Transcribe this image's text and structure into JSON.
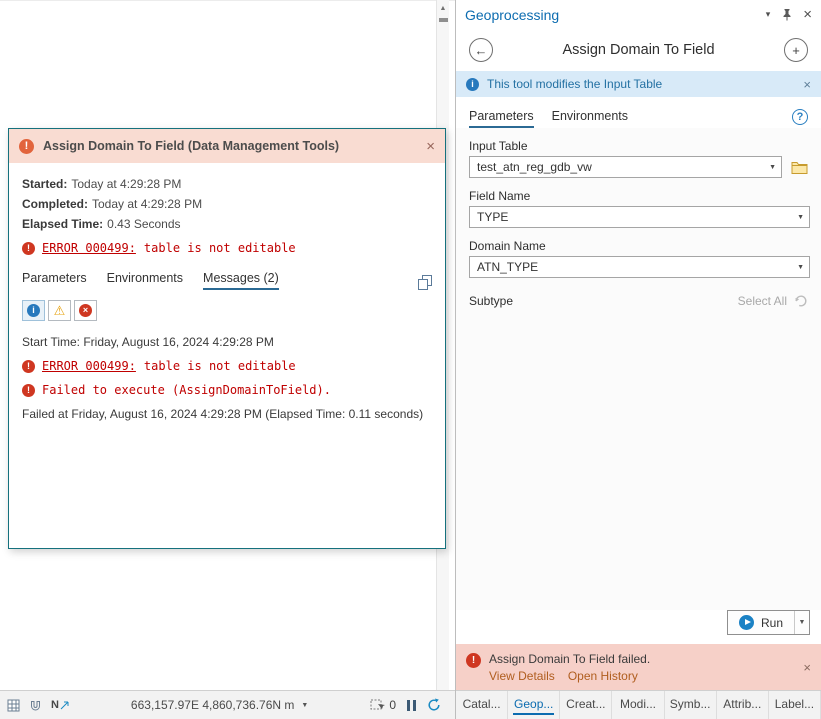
{
  "colors": {
    "accent_blue": "#0c6cb0",
    "error_red": "#c00000",
    "error_salmon_bg": "#f6d0c8",
    "dialog_header_bg": "#f9dcd2",
    "info_bar_bg": "#d8eaf8",
    "dialog_border": "#15717d",
    "link_orange": "#b05e1f"
  },
  "icons": {
    "scroll_up": "▲",
    "caret_down": "▾",
    "close": "×",
    "back_arrow": "←",
    "add": "+",
    "info": "i",
    "help": "?",
    "combo_arrow": "▼",
    "exclamation": "!",
    "warning_triangle": "⚠",
    "north": "N"
  },
  "dialog": {
    "title": "Assign Domain To Field (Data Management Tools)",
    "meta": [
      {
        "label": "Started:",
        "value": "Today at 4:29:28 PM"
      },
      {
        "label": "Completed:",
        "value": "Today at 4:29:28 PM"
      },
      {
        "label": "Elapsed Time:",
        "value": "0.43 Seconds"
      }
    ],
    "summary_error": {
      "link": "ERROR 000499:",
      "text": "table is not editable"
    },
    "tabs": [
      {
        "label": "Parameters"
      },
      {
        "label": "Environments"
      },
      {
        "label": "Messages (2)"
      }
    ],
    "messages": {
      "start_line": "Start Time: Friday, August 16, 2024 4:29:28 PM",
      "error1": {
        "link": "ERROR 000499:",
        "text": "table is not editable"
      },
      "error2": "Failed to execute (AssignDomainToField).",
      "failed_line": "Failed at Friday, August 16, 2024 4:29:28 PM (Elapsed Time: 0.11 seconds)"
    }
  },
  "statusbar": {
    "coordinates": "663,157.97E 4,860,736.76N m",
    "selection_count": "0"
  },
  "gp": {
    "pane_title": "Geoprocessing",
    "tool_title": "Assign Domain To Field",
    "info_message": "This tool modifies the Input Table",
    "tabs": [
      {
        "label": "Parameters"
      },
      {
        "label": "Environments"
      }
    ],
    "fields": {
      "input_table": {
        "label": "Input Table",
        "value": "test_atn_reg_gdb_vw"
      },
      "field_name": {
        "label": "Field Name",
        "value": "TYPE"
      },
      "domain_name": {
        "label": "Domain Name",
        "value": "ATN_TYPE"
      }
    },
    "subtype": {
      "label": "Subtype",
      "action": "Select All"
    },
    "run_label": "Run",
    "notification": {
      "title": "Assign Domain To Field failed.",
      "view_details": "View Details",
      "open_history": "Open History"
    },
    "bottom_tabs": [
      {
        "label": "Catal..."
      },
      {
        "label": "Geop..."
      },
      {
        "label": "Creat..."
      },
      {
        "label": "Modi..."
      },
      {
        "label": "Symb..."
      },
      {
        "label": "Attrib..."
      },
      {
        "label": "Label..."
      }
    ]
  }
}
